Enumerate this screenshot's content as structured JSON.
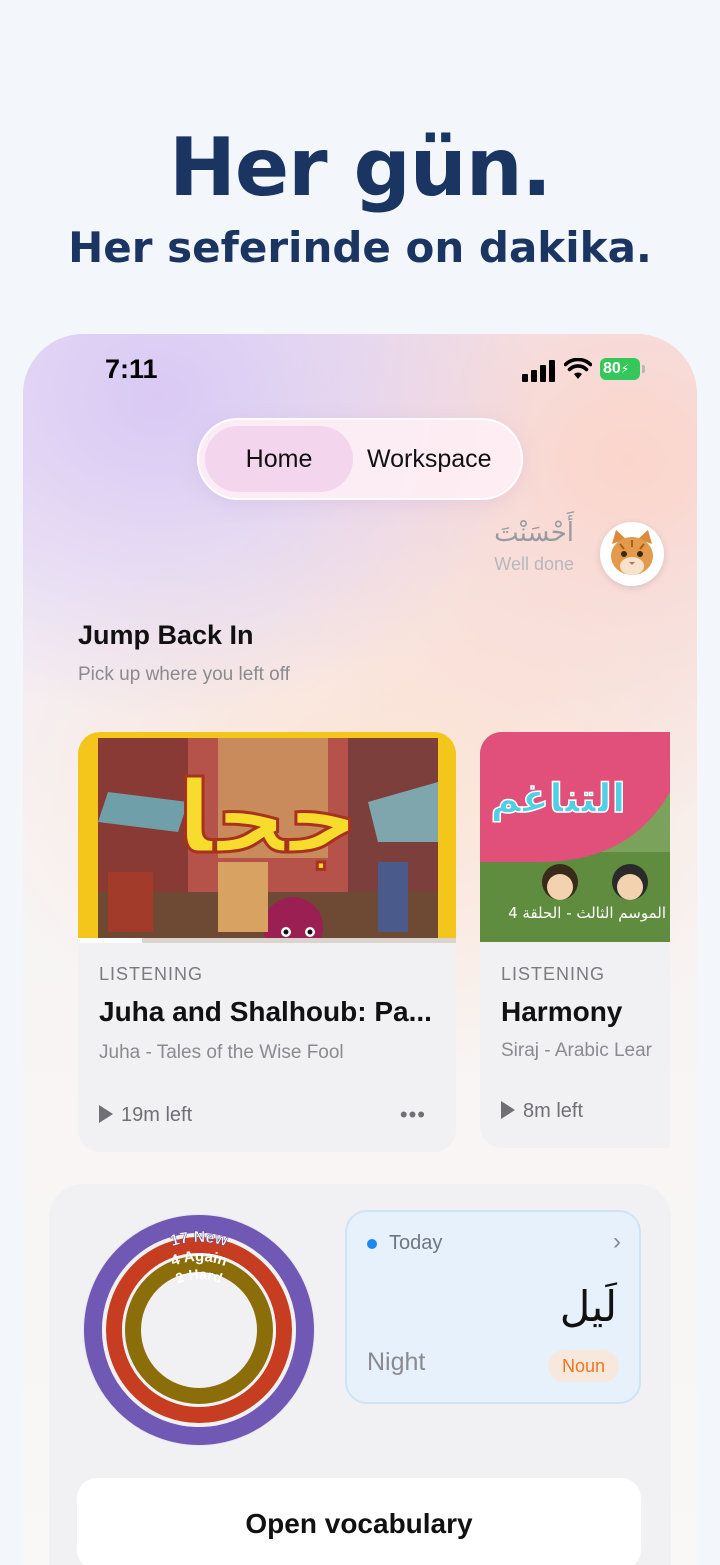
{
  "hero": {
    "line1": "Her gün.",
    "line2": "Her seferinde on dakika."
  },
  "status_bar": {
    "time": "7:11",
    "battery": "80"
  },
  "segmented": {
    "home": "Home",
    "workspace": "Workspace",
    "selected": "Home"
  },
  "greeting": {
    "arabic": "أَحْسَنْتَ",
    "english": "Well done"
  },
  "jump_back": {
    "title": "Jump Back In",
    "subtitle": "Pick up where you left off"
  },
  "cards": [
    {
      "kind": "LISTENING",
      "title": "Juha and Shalhoub: Pa...",
      "series": "Juha - Tales of the Wise Fool",
      "remaining": "19m left",
      "more": "•••",
      "art_title": "جحا",
      "progress": 0.17
    },
    {
      "kind": "LISTENING",
      "title": "Harmony",
      "series": "Siraj - Arabic Lear",
      "remaining": "8m left",
      "art_title": "التناغم",
      "art_caption": "الموسم الثالث - الحلقة 4"
    }
  ],
  "review": {
    "rings": [
      {
        "label": "17 New",
        "color": "#7059b4"
      },
      {
        "label": "4 Again",
        "color": "#c63d21"
      },
      {
        "label": "2 Hard",
        "color": "#8b6e0a"
      }
    ]
  },
  "today": {
    "label": "Today",
    "word": "لَيل",
    "gloss": "Night",
    "pos": "Noun"
  },
  "open_vocab": "Open vocabulary"
}
